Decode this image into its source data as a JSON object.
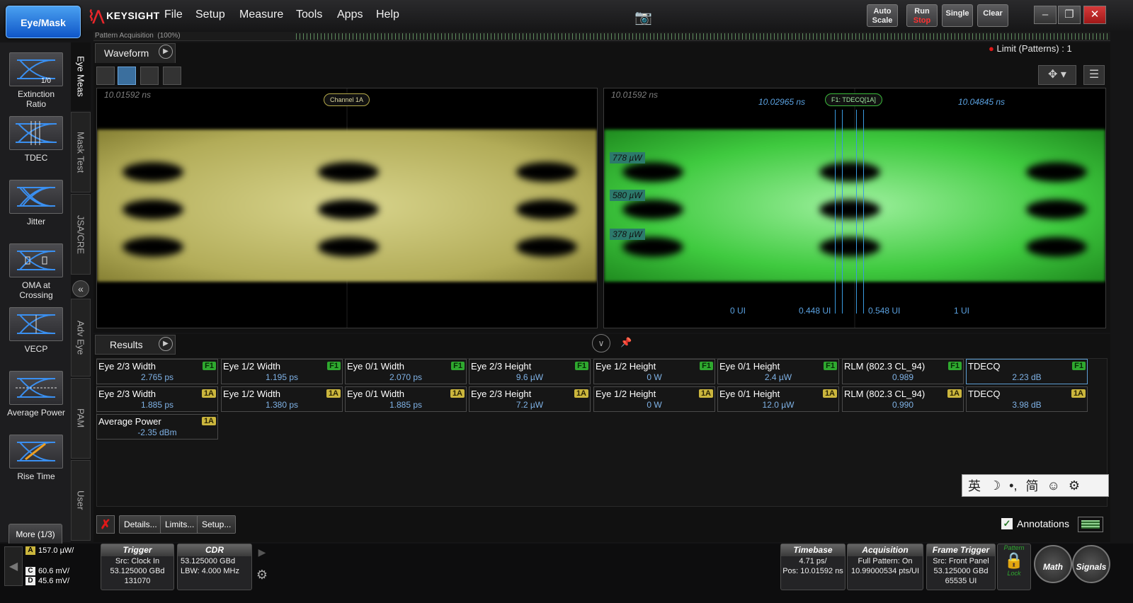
{
  "app": {
    "mode_button": "Eye/Mask",
    "brand": "KEYSIGHT",
    "menus": [
      "File",
      "Setup",
      "Measure",
      "Tools",
      "Apps",
      "Help"
    ]
  },
  "toolbar": {
    "autoscale": [
      "Auto",
      "Scale"
    ],
    "run": [
      "Run",
      "Stop"
    ],
    "single": "Single",
    "clear": "Clear"
  },
  "left_tools": [
    {
      "label": "Extinction Ratio",
      "icon": "extinction-ratio-icon"
    },
    {
      "label": "TDEC",
      "icon": "tdec-icon"
    },
    {
      "label": "Jitter",
      "icon": "jitter-icon"
    },
    {
      "label": "OMA at Crossing",
      "icon": "oma-crossing-icon"
    },
    {
      "label": "VECP",
      "icon": "vecp-icon"
    },
    {
      "label": "Average Power",
      "icon": "average-power-icon"
    },
    {
      "label": "Rise Time",
      "icon": "rise-time-icon"
    }
  ],
  "more_button": "More (1/3)",
  "vertical_tabs": [
    "Eye Meas",
    "Mask Test",
    "JSA/CRE",
    "Adv Eye",
    "PAM",
    "User"
  ],
  "acquisition": {
    "label": "Pattern Acquisition",
    "percent": "(100%)",
    "progress": 1.0
  },
  "waveform": {
    "tab": "Waveform",
    "limit": "Limit (Patterns) : 1",
    "left": {
      "timestamp": "10.01592 ns",
      "channel": "Channel 1A"
    },
    "right": {
      "timestamp": "10.01592 ns",
      "tag": "F1: TDECQ[1A]",
      "t1": "10.02965 ns",
      "t2": "10.04845 ns",
      "levels": [
        "778 µW",
        "580 µW",
        "378 µW"
      ],
      "ui": [
        "0 UI",
        "0.448 UI",
        "0.548 UI",
        "1 UI"
      ]
    }
  },
  "results": {
    "tab": "Results",
    "row1": [
      {
        "name": "Eye 2/3 Width",
        "badge": "F1",
        "value": "2.765 ps"
      },
      {
        "name": "Eye 1/2 Width",
        "badge": "F1",
        "value": "1.195 ps"
      },
      {
        "name": "Eye 0/1 Width",
        "badge": "F1",
        "value": "2.070 ps"
      },
      {
        "name": "Eye 2/3 Height",
        "badge": "F1",
        "value": "9.6 µW"
      },
      {
        "name": "Eye 1/2 Height",
        "badge": "F1",
        "value": "0 W"
      },
      {
        "name": "Eye 0/1 Height",
        "badge": "F1",
        "value": "2.4 µW"
      },
      {
        "name": "RLM (802.3 CL_94)",
        "badge": "F1",
        "value": "0.989"
      },
      {
        "name": "TDECQ",
        "badge": "F1",
        "value": "2.23 dB"
      }
    ],
    "row2": [
      {
        "name": "Eye 2/3 Width",
        "badge": "1A",
        "value": "1.885 ps"
      },
      {
        "name": "Eye 1/2 Width",
        "badge": "1A",
        "value": "1.380 ps"
      },
      {
        "name": "Eye 0/1 Width",
        "badge": "1A",
        "value": "1.885 ps"
      },
      {
        "name": "Eye 2/3 Height",
        "badge": "1A",
        "value": "7.2 µW"
      },
      {
        "name": "Eye 1/2 Height",
        "badge": "1A",
        "value": "0 W"
      },
      {
        "name": "Eye 0/1 Height",
        "badge": "1A",
        "value": "12.0 µW"
      },
      {
        "name": "RLM (802.3 CL_94)",
        "badge": "1A",
        "value": "0.990"
      },
      {
        "name": "TDECQ",
        "badge": "1A",
        "value": "3.98 dB"
      }
    ],
    "row3": [
      {
        "name": "Average Power",
        "badge": "1A",
        "value": "-2.35 dBm"
      }
    ],
    "buttons": {
      "details": "Details...",
      "limits": "Limits...",
      "setup": "Setup..."
    },
    "annotations": "Annotations"
  },
  "ime": [
    "英",
    "☽",
    "•,",
    "简",
    "☺",
    "⚙"
  ],
  "status": {
    "ch_a": "157.0 µW/",
    "ch_c": "60.6 mV/",
    "ch_d": "45.6 mV/",
    "trigger": {
      "title": "Trigger",
      "src": "Src: Clock In",
      "rate": "53.125000 GBd",
      "count": "131070"
    },
    "cdr": {
      "title": "CDR",
      "rate": "53.125000 GBd",
      "lbw": "LBW: 4.000 MHz"
    },
    "timebase": {
      "title": "Timebase",
      "scale": "4.71 ps/",
      "pos": "Pos: 10.01592 ns"
    },
    "acquisition": {
      "title": "Acquisition",
      "mode": "Full Pattern: On",
      "pts": "10.99000534 pts/UI"
    },
    "frame": {
      "title": "Frame Trigger",
      "src": "Src: Front Panel",
      "rate": "53.125000 GBd",
      "ui": "65535 UI"
    },
    "pattern": [
      "Pattern",
      "Lock"
    ],
    "math": "Math",
    "signals": "Signals"
  }
}
